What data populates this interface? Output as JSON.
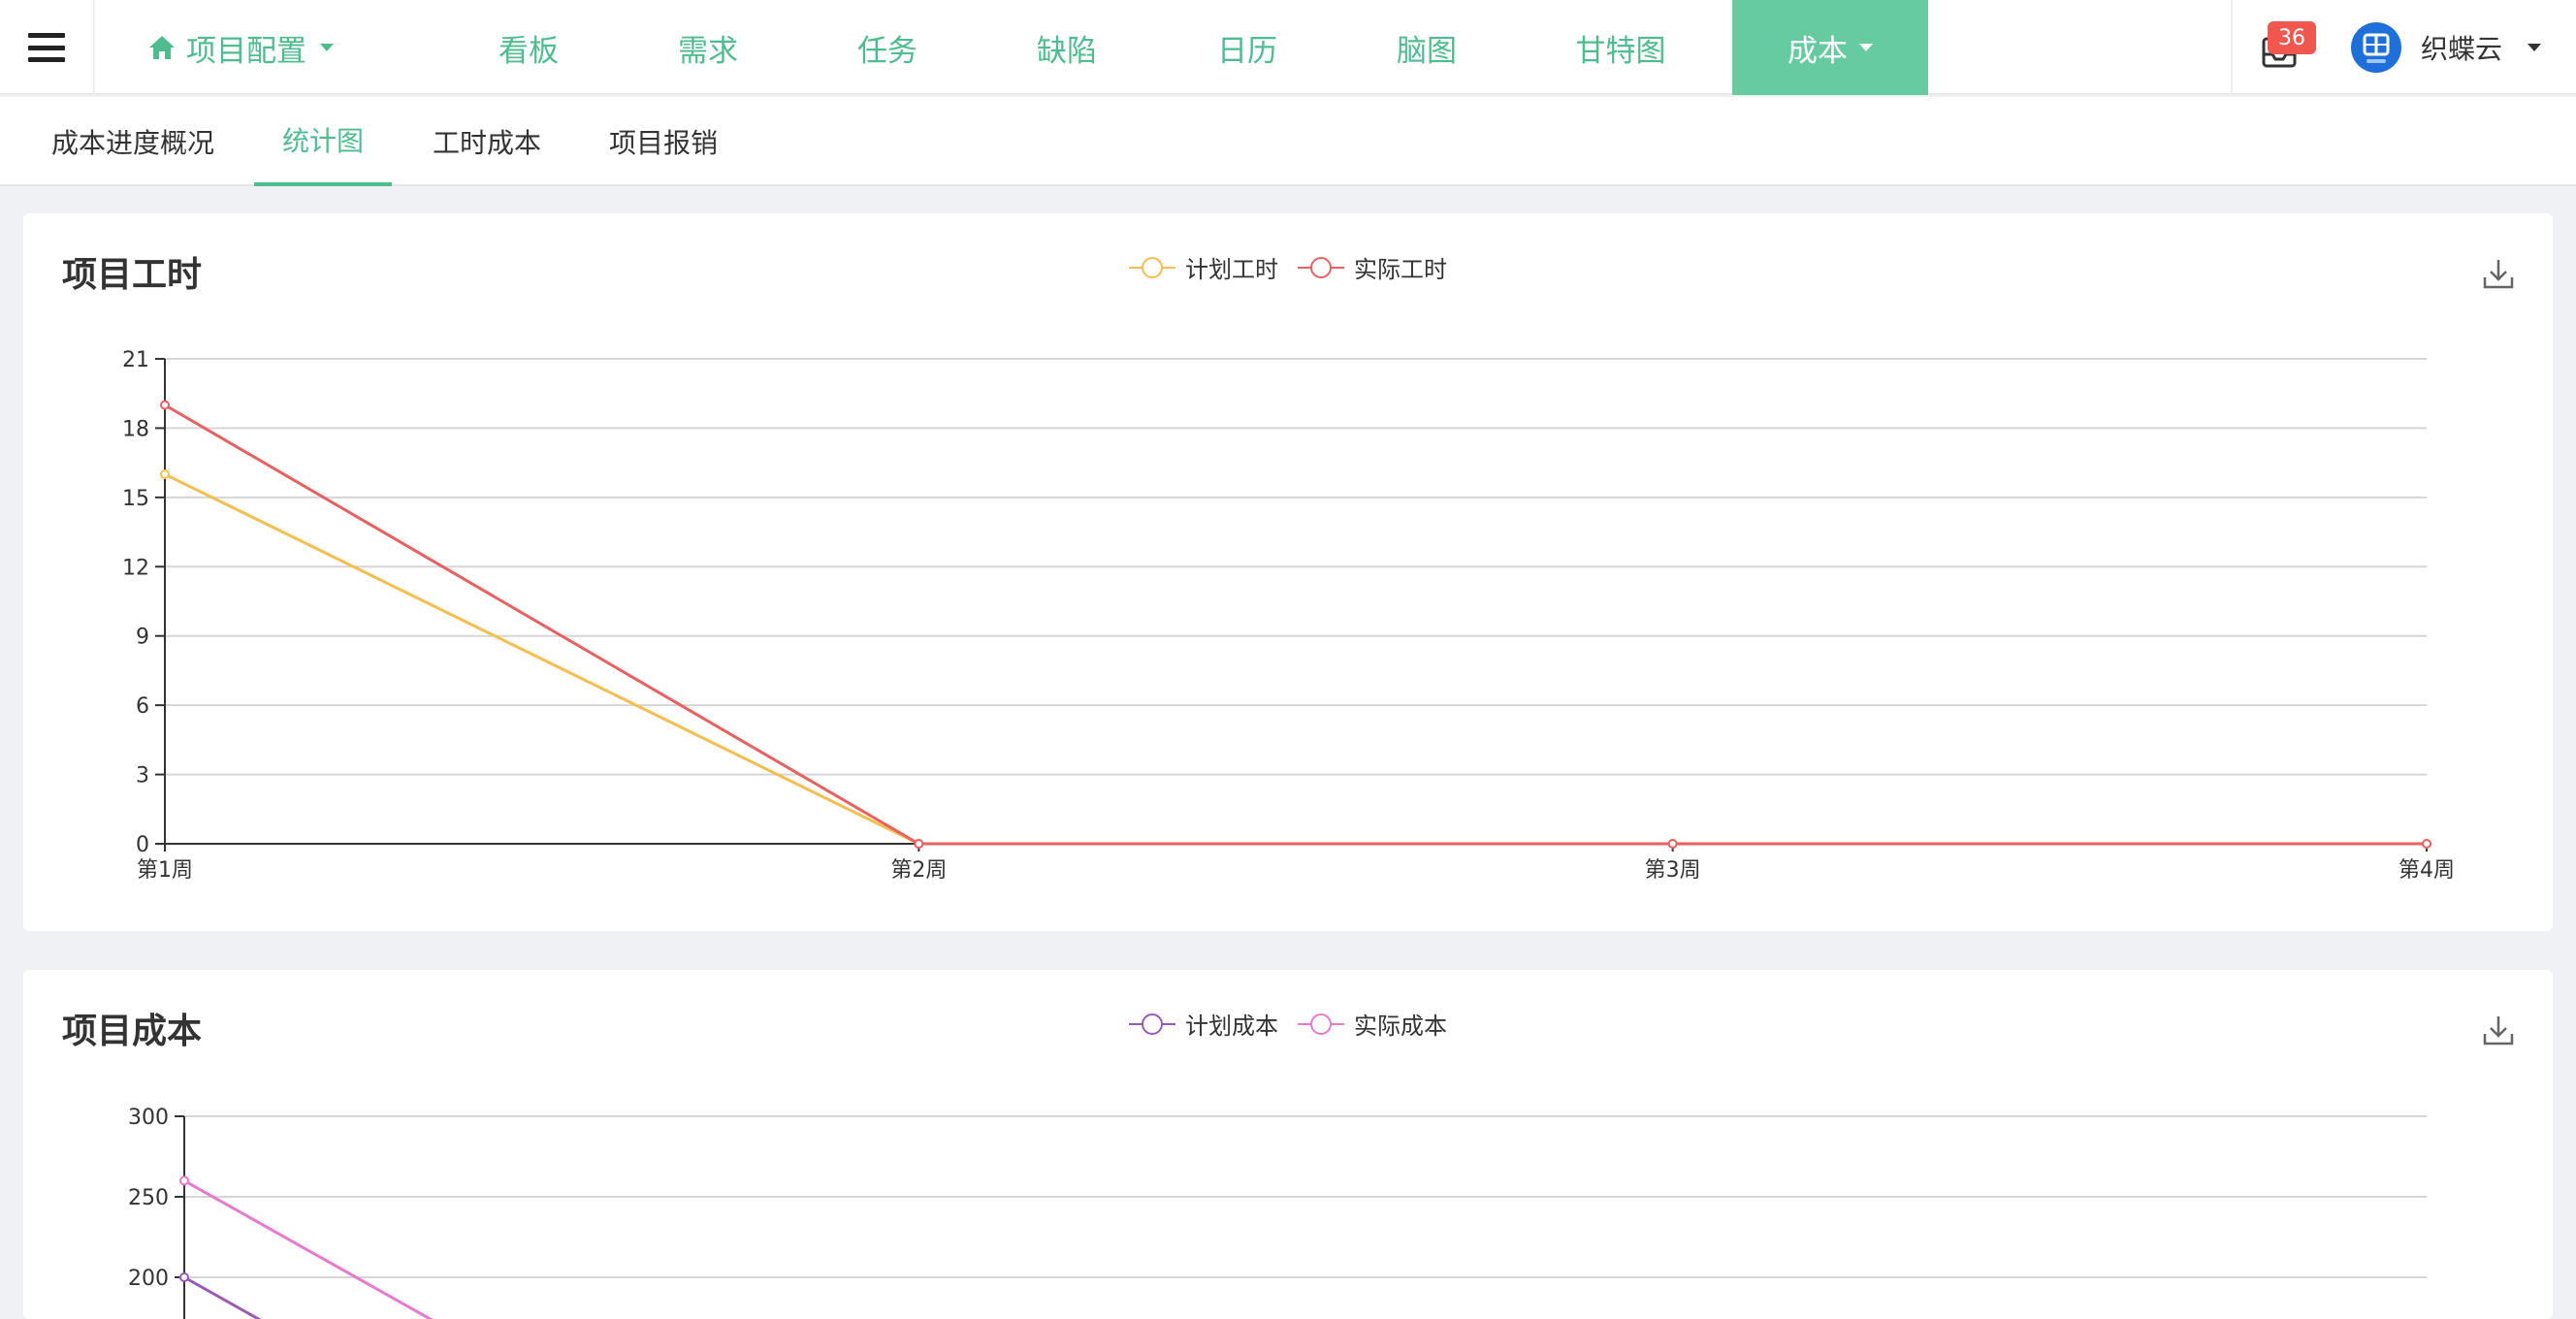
{
  "nav": {
    "project_label": "项目配置",
    "items": [
      {
        "label": "看板"
      },
      {
        "label": "需求"
      },
      {
        "label": "任务"
      },
      {
        "label": "缺陷"
      },
      {
        "label": "日历"
      },
      {
        "label": "脑图"
      },
      {
        "label": "甘特图"
      },
      {
        "label": "成本"
      }
    ],
    "message_count": "36",
    "user_name": "织蝶云"
  },
  "subtabs": [
    {
      "label": "成本进度概况"
    },
    {
      "label": "统计图"
    },
    {
      "label": "工时成本"
    },
    {
      "label": "项目报销"
    }
  ],
  "colors": {
    "accent": "#4fbc8f",
    "active_nav_bg": "#66cca0",
    "badge": "#f0584f",
    "planned_hours": "#f5be4f",
    "actual_hours": "#e8605f",
    "planned_cost": "#9b59b6",
    "actual_cost": "#e879cf"
  },
  "chart_data": [
    {
      "type": "line",
      "title": "项目工时",
      "categories": [
        "第1周",
        "第2周",
        "第3周",
        "第4周"
      ],
      "series": [
        {
          "name": "计划工时",
          "values": [
            16,
            0,
            0,
            0
          ]
        },
        {
          "name": "实际工时",
          "values": [
            19,
            0,
            0,
            0
          ]
        }
      ],
      "ylim": [
        0,
        21
      ],
      "yticks": [
        0,
        3,
        6,
        9,
        12,
        15,
        18,
        21
      ],
      "grid": true,
      "legend": "top-center"
    },
    {
      "type": "line",
      "title": "项目成本",
      "series": [
        {
          "name": "计划成本",
          "values": [
            200
          ]
        },
        {
          "name": "实际成本",
          "values": [
            260
          ]
        }
      ],
      "ylim": [
        0,
        300
      ],
      "yticks": [
        200,
        250,
        300
      ],
      "grid": true,
      "legend": "top-center"
    }
  ]
}
